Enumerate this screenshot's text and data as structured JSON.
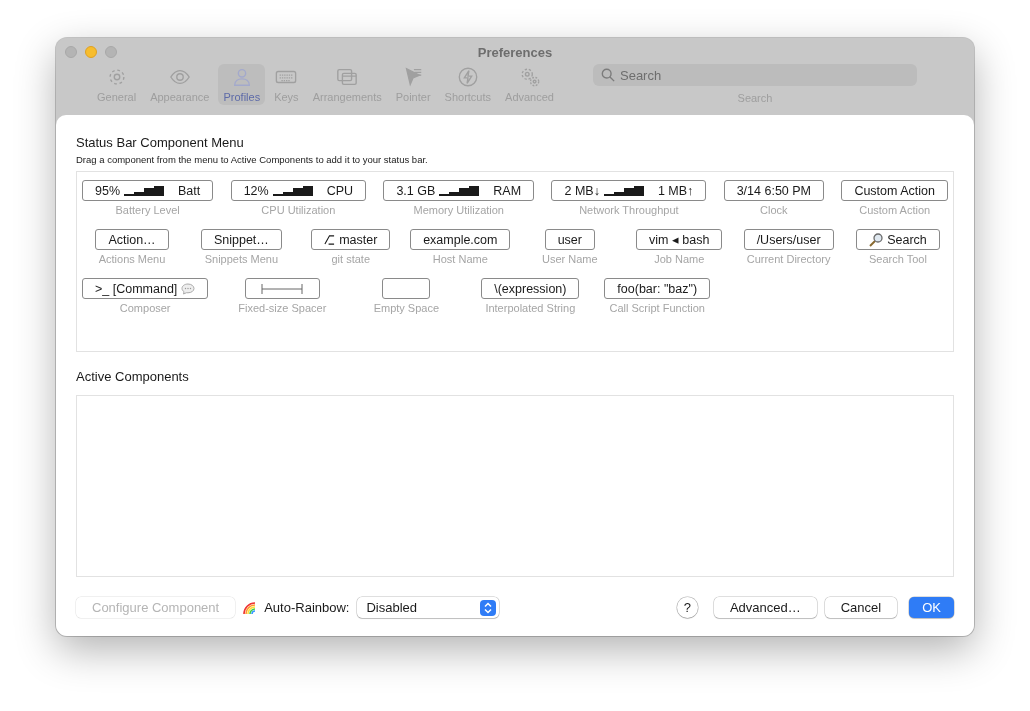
{
  "window": {
    "title": "Preferences"
  },
  "toolbar": [
    {
      "label": "General",
      "selected": false
    },
    {
      "label": "Appearance",
      "selected": false
    },
    {
      "label": "Profiles",
      "selected": true
    },
    {
      "label": "Keys",
      "selected": false
    },
    {
      "label": "Arrangements",
      "selected": false
    },
    {
      "label": "Pointer",
      "selected": false
    },
    {
      "label": "Shortcuts",
      "selected": false
    },
    {
      "label": "Advanced",
      "selected": false
    }
  ],
  "search": {
    "placeholder": "Search",
    "label": "Search"
  },
  "sheet": {
    "title": "Status Bar Component Menu",
    "subtitle": "Drag a component from the menu to Active Components to add it to your status bar.",
    "component_rows": [
      [
        {
          "kind": "meter",
          "prefix": "95%",
          "suffix": "Batt",
          "label": "Battery Level"
        },
        {
          "kind": "meter",
          "prefix": "12%",
          "suffix": "CPU",
          "label": "CPU Utilization"
        },
        {
          "kind": "meter",
          "prefix": "3.1 GB",
          "suffix": "RAM",
          "label": "Memory Utilization"
        },
        {
          "kind": "meter",
          "prefix": "2 MB↓",
          "suffix": "1 MB↑",
          "label": "Network Throughput"
        },
        {
          "kind": "text",
          "preview": "3/14 6:50 PM",
          "label": "Clock"
        },
        {
          "kind": "text",
          "preview": "Custom Action",
          "label": "Custom Action"
        }
      ],
      [
        {
          "kind": "text",
          "preview": "Action…",
          "label": "Actions Menu"
        },
        {
          "kind": "text",
          "preview": "Snippet…",
          "label": "Snippets Menu"
        },
        {
          "kind": "branch",
          "preview": "master",
          "label": "git state"
        },
        {
          "kind": "text",
          "preview": "example.com",
          "label": "Host Name"
        },
        {
          "kind": "text",
          "preview": "user",
          "label": "User Name"
        },
        {
          "kind": "text",
          "preview": "vim ◂ bash",
          "label": "Job Name"
        },
        {
          "kind": "text",
          "preview": "/Users/user",
          "label": "Current Directory"
        },
        {
          "kind": "search",
          "preview": "Search",
          "label": "Search Tool"
        }
      ],
      [
        {
          "kind": "composer",
          "preview": ">_ [Command]",
          "label": "Composer"
        },
        {
          "kind": "spacer",
          "label": "Fixed-size Spacer"
        },
        {
          "kind": "empty",
          "label": "Empty Space"
        },
        {
          "kind": "text",
          "preview": "\\(expression)",
          "label": "Interpolated String"
        },
        {
          "kind": "text",
          "preview": "foo(bar: \"baz\")",
          "label": "Call Script Function"
        }
      ]
    ],
    "active_title": "Active Components",
    "configure_button": {
      "label": "Configure Component",
      "disabled": true
    },
    "auto_rainbow": {
      "label": "Auto-Rainbow:",
      "value": "Disabled"
    },
    "help_button": "?",
    "buttons": [
      {
        "label": "Advanced…",
        "kind": "normal"
      },
      {
        "label": "Cancel",
        "kind": "normal"
      },
      {
        "label": "OK",
        "kind": "default"
      }
    ]
  }
}
